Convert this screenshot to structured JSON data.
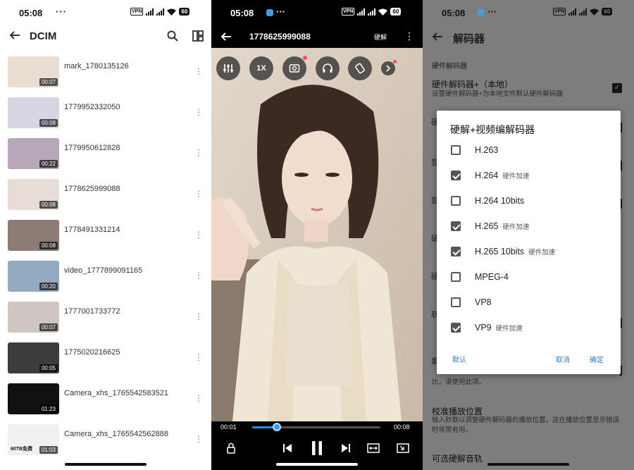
{
  "status_bar": {
    "time": "05:08",
    "dots": "···",
    "vpn": "VPN",
    "battery": "60"
  },
  "gallery": {
    "title": "DCIM",
    "icons": {
      "back": "arrow-left-icon",
      "search": "search-icon",
      "layout": "grid-layout-icon",
      "more": "more-vertical-icon"
    },
    "videos": [
      {
        "name": "mark_1780135126",
        "duration": "00:07",
        "thumb": "#e9ddd2"
      },
      {
        "name": "1779952332050",
        "duration": "00:08",
        "thumb": "#d8d4e4"
      },
      {
        "name": "1779950612828",
        "duration": "00:22",
        "thumb": "#b7a7b8"
      },
      {
        "name": "1778625999088",
        "duration": "00:08",
        "thumb": "#e7ddd6"
      },
      {
        "name": "1778491331214",
        "duration": "00:08",
        "thumb": "#8d7b76"
      },
      {
        "name": "video_1777899091165",
        "duration": "00:20",
        "thumb": "#94aac0"
      },
      {
        "name": "1777001733772",
        "duration": "00:07",
        "thumb": "#cfc6c2"
      },
      {
        "name": "1775020216625",
        "duration": "00:05",
        "thumb": "#3d3b3e"
      },
      {
        "name": "Camera_xhs_1765542583521",
        "duration": "01:23",
        "thumb": "#111111"
      },
      {
        "name": "Camera_xhs_1765542562888",
        "duration": "01:03",
        "thumb": "#f1f1f1",
        "overlay_text": "60TB免费"
      }
    ]
  },
  "player": {
    "title": "1778625999088",
    "hw_label": "硬解",
    "speed_label": "1X",
    "current_time": "00:01",
    "total_time": "00:08",
    "progress": 0.19,
    "icons": {
      "back": "arrow-left-icon",
      "more": "more-vertical-icon",
      "equalizer": "equalizer-icon",
      "screenshot": "camera-capture-icon",
      "audio": "headphones-icon",
      "rotate": "screen-rotate-icon",
      "expand": "chevron-right-icon",
      "lock": "lock-icon",
      "prev": "skip-previous-icon",
      "pause": "pause-icon",
      "next": "skip-next-icon",
      "aspect": "aspect-ratio-icon",
      "pip": "picture-in-picture-icon"
    }
  },
  "decoder_settings": {
    "title": "解码器",
    "section": "硬件解码器",
    "items": [
      {
        "title": "硬件解码器+（本地）",
        "subtitle": "设置硬件解码器+为本地文件默认硬件解码器",
        "checked": true
      }
    ],
    "partial_edge_labels": [
      "硬",
      "尝",
      "尝",
      "硬",
      "硬",
      "软",
      "偏"
    ],
    "lower_items": [
      {
        "title": "",
        "subtitle": "比，请使用此项。"
      },
      {
        "title": "校准播放位置",
        "subtitle": "输入秒数以调整硬件解码器的播放位置。这在播放位置显示错误时非常有用。"
      },
      {
        "title": "可选硬解音轨",
        "subtitle": ""
      }
    ],
    "dialog": {
      "title": "硬解+视频编解码器",
      "options": [
        {
          "label": "H.263",
          "hint": "",
          "checked": false
        },
        {
          "label": "H.264",
          "hint": "硬件加速",
          "checked": true
        },
        {
          "label": "H.264 10bits",
          "hint": "",
          "checked": false
        },
        {
          "label": "H.265",
          "hint": "硬件加速",
          "checked": true
        },
        {
          "label": "H.265 10bits",
          "hint": "硬件加速",
          "checked": true
        },
        {
          "label": "MPEG-4",
          "hint": "",
          "checked": false
        },
        {
          "label": "VP8",
          "hint": "",
          "checked": false
        },
        {
          "label": "VP9",
          "hint": "硬件加速",
          "checked": true
        }
      ],
      "btn_default": "默认",
      "btn_cancel": "取消",
      "btn_ok": "确定"
    }
  }
}
